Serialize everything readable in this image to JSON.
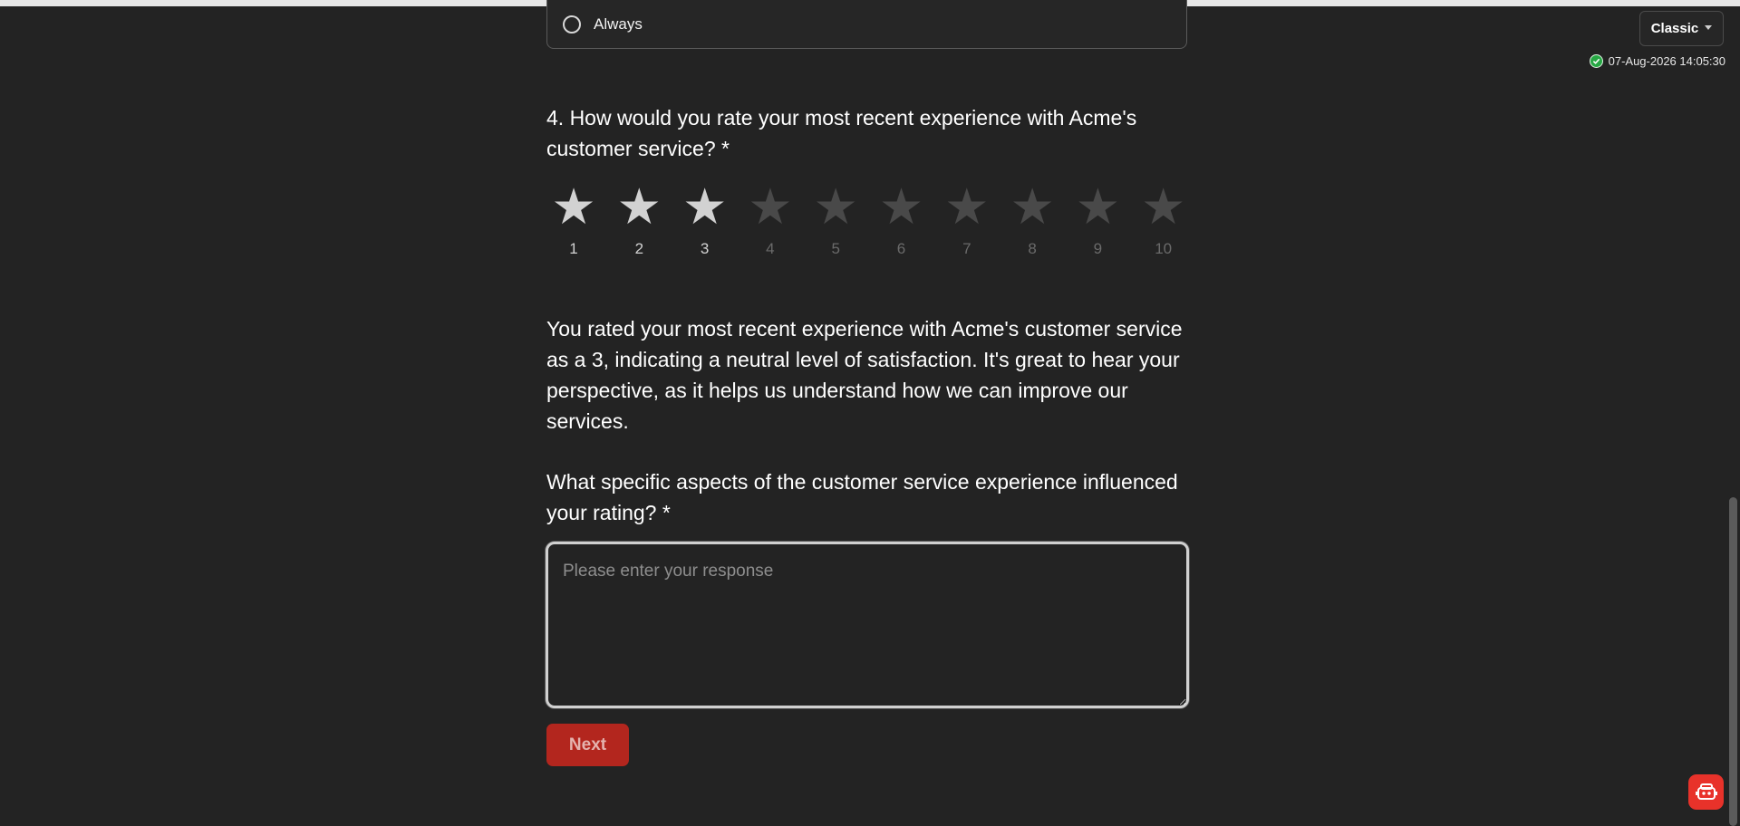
{
  "previous_question": {
    "last_option_label": "Always"
  },
  "header": {
    "mode_label": "Classic",
    "saved_timestamp": "07-Aug-2026 14:05:30"
  },
  "question4": {
    "title": "4. How would you rate your most recent experience with Acme's customer service? *",
    "rating_scale": [
      "1",
      "2",
      "3",
      "4",
      "5",
      "6",
      "7",
      "8",
      "9",
      "10"
    ],
    "selected_rating": 3,
    "star_glyph": "★",
    "colors": {
      "star_selected": "#d2d2d2",
      "star_unselected": "#494949"
    }
  },
  "feedback": {
    "text": "You rated your most recent experience with Acme's customer service as a 3, indicating a neutral level of satisfaction. It's great to hear your perspective, as it helps us understand how we can improve our services."
  },
  "followup": {
    "question": "What specific aspects of the customer service experience influenced your rating? *",
    "response_value": "",
    "response_placeholder": "Please enter your response"
  },
  "actions": {
    "next_label": "Next",
    "next_color": "#b3261e"
  },
  "icons": {
    "mode_caret": "chevron-down-icon",
    "saved_status": "check-circle-icon",
    "helper": "assistant-robot-icon"
  }
}
